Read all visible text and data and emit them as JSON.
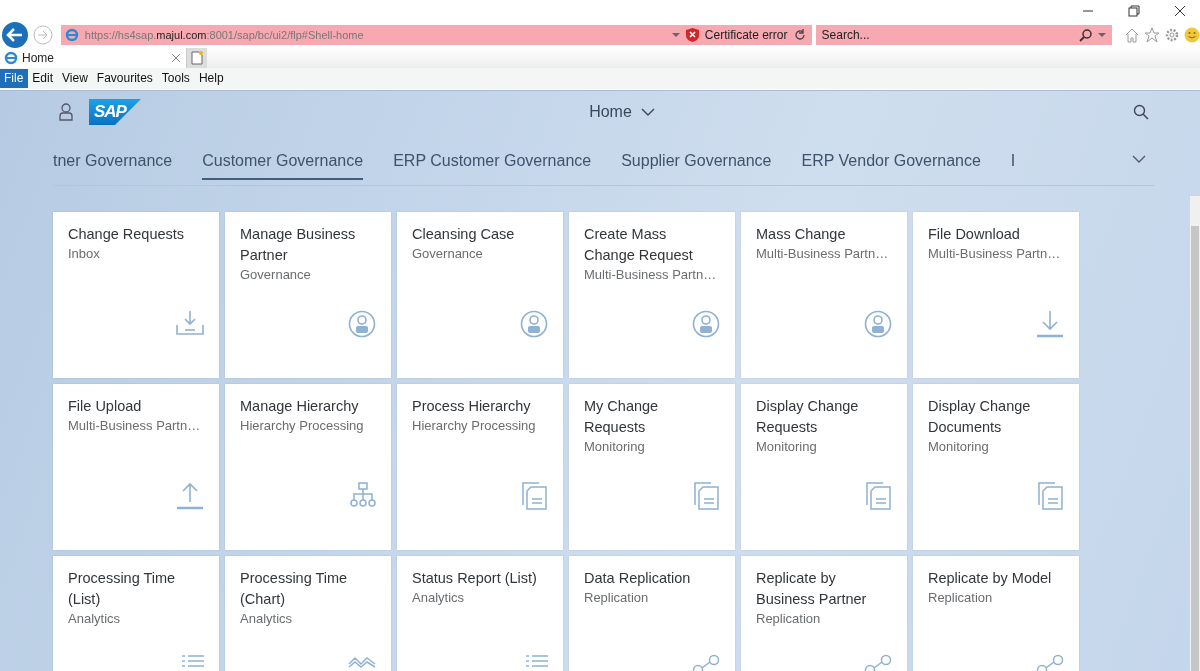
{
  "browser": {
    "address": "https://hs4sap.**majul.com**:8001/sap/bc/ui2/flp#Shell-home",
    "certificate": "Certificate error",
    "search": {
      "placeholder": "Search..."
    },
    "tabs": [
      {
        "label": "Home",
        "selected": true
      }
    ],
    "menu": [
      {
        "label": "File",
        "selected": true
      },
      {
        "label": "Edit",
        "selected": false
      },
      {
        "label": "View",
        "selected": false
      },
      {
        "label": "Favourites",
        "selected": false
      },
      {
        "label": "Tools",
        "selected": false
      },
      {
        "label": "Help",
        "selected": false
      }
    ]
  },
  "shell": {
    "logo": "SAP",
    "title": "Home",
    "groups": [
      {
        "label": "tner Governance",
        "selected": false
      },
      {
        "label": "Customer Governance",
        "selected": true
      },
      {
        "label": "ERP Customer Governance",
        "selected": false
      },
      {
        "label": "Supplier Governance",
        "selected": false
      },
      {
        "label": "ERP Vendor Governance",
        "selected": false
      },
      {
        "label": "I",
        "selected": false
      }
    ],
    "tiles": [
      {
        "title": "Change Requests",
        "subtitle": "Inbox",
        "kind": "inbox"
      },
      {
        "title": "Manage Business Partner",
        "subtitle": "Governance",
        "kind": "person"
      },
      {
        "title": "Cleansing Case",
        "subtitle": "Governance",
        "kind": "person"
      },
      {
        "title": "Create Mass Change Request",
        "subtitle": "Multi-Business Partn…",
        "kind": "person"
      },
      {
        "title": "Mass Change",
        "subtitle": "Multi-Business Partn…",
        "kind": "person"
      },
      {
        "title": "File Download",
        "subtitle": "Multi-Business Partn…",
        "kind": "download"
      },
      {
        "title": "File Upload",
        "subtitle": "Multi-Business Partn…",
        "kind": "upload"
      },
      {
        "title": "Manage Hierarchy",
        "subtitle": "Hierarchy Processing",
        "kind": "hierarchy"
      },
      {
        "title": "Process Hierarchy",
        "subtitle": "Hierarchy Processing",
        "kind": "documents"
      },
      {
        "title": "My Change Requests",
        "subtitle": "Monitoring",
        "kind": "documents"
      },
      {
        "title": "Display Change Requests",
        "subtitle": "Monitoring",
        "kind": "documents"
      },
      {
        "title": "Display Change Documents",
        "subtitle": "Monitoring",
        "kind": "documents"
      },
      {
        "title": "Processing Time (List)",
        "subtitle": "Analytics",
        "kind": "list"
      },
      {
        "title": "Processing Time (Chart)",
        "subtitle": "Analytics",
        "kind": "chart"
      },
      {
        "title": "Status Report (List)",
        "subtitle": "Analytics",
        "kind": "list"
      },
      {
        "title": "Data Replication",
        "subtitle": "Replication",
        "kind": "share"
      },
      {
        "title": "Replicate by Business Partner",
        "subtitle": "Replication",
        "kind": "share"
      },
      {
        "title": "Replicate by Model",
        "subtitle": "Replication",
        "kind": "share"
      }
    ]
  }
}
